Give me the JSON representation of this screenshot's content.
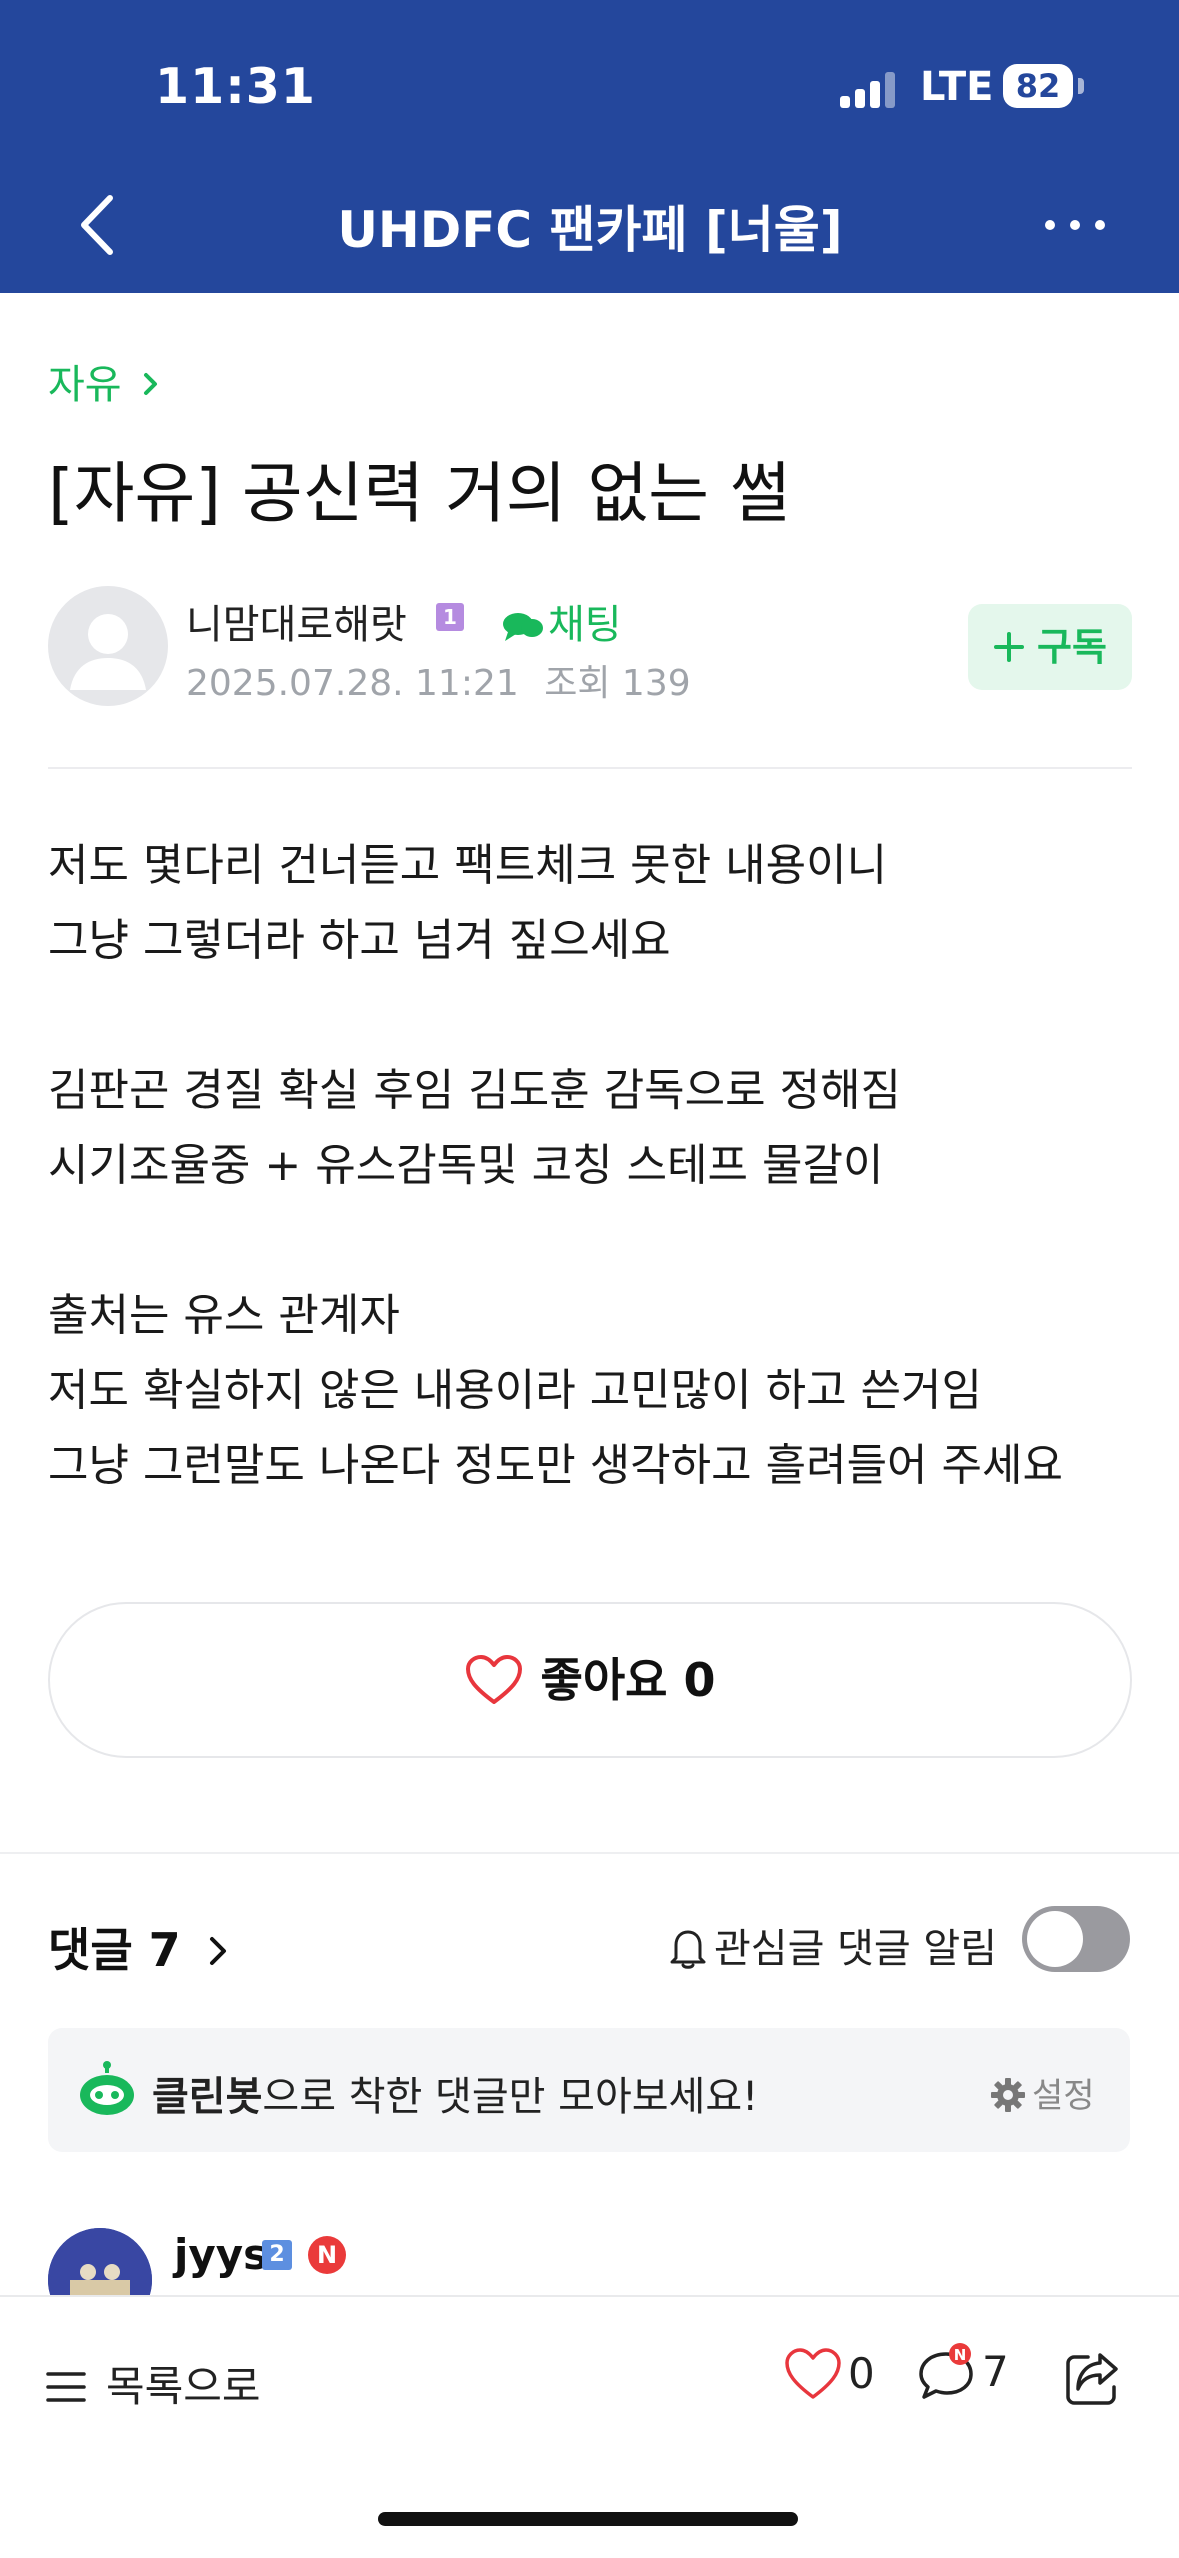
{
  "status_bar": {
    "time": "11:31",
    "network": "LTE",
    "battery": "82"
  },
  "header": {
    "title": "UHDFC 팬카페 [너울]"
  },
  "post": {
    "category": "자유",
    "title": "[자유] 공신력 거의 없는 썰",
    "author": "니맘대로해랏",
    "author_level": "1",
    "chat_label": "채팅",
    "date": "2025.07.28. 11:21",
    "views_label": "조회",
    "views": "139",
    "subscribe_label": "구독",
    "body_lines": [
      "저도 몇다리 건너듣고 팩트체크 못한 내용이니",
      "그냥 그렇더라 하고 넘겨 짚으세요",
      "",
      "김판곤 경질 확실 후임 김도훈 감독으로 정해짐",
      "시기조율중 + 유스감독및 코칭 스테프 물갈이",
      "",
      "출처는 유스 관계자",
      "저도 확실하지 않은 내용이라 고민많이 하고 쓴거임",
      "그냥 그런말도 나온다 정도만 생각하고 흘려들어 주세요"
    ],
    "like_label": "좋아요",
    "like_count": "0"
  },
  "comments": {
    "title": "댓글",
    "count": "7",
    "notify_label": "관심글 댓글 알림",
    "notify_on": false,
    "cleanbot_name": "클린봇",
    "cleanbot_text": "으로 착한 댓글만 모아보세요!",
    "settings_label": "설정",
    "first_comment": {
      "author": "jyys",
      "level": "2",
      "badge": "N"
    }
  },
  "bottom_bar": {
    "list_label": "목록으로",
    "like_count": "0",
    "comment_count": "7",
    "comment_badge": "N"
  },
  "colors": {
    "header_bg": "#24479c",
    "accent_green": "#19b85b",
    "like_red": "#e8363d"
  }
}
